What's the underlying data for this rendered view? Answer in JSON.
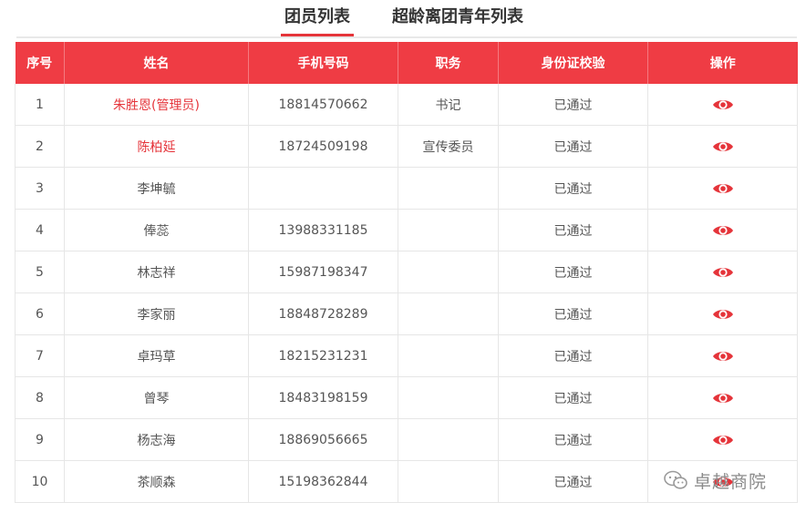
{
  "tabs": [
    {
      "label": "团员列表",
      "active": true
    },
    {
      "label": "超龄离团青年列表",
      "active": false
    }
  ],
  "table": {
    "headers": [
      "序号",
      "姓名",
      "手机号码",
      "职务",
      "身份证校验",
      "操作"
    ],
    "rows": [
      {
        "no": "1",
        "name": "朱胜恩(管理员)",
        "phone": "18814570662",
        "role": "书记",
        "id_check": "已通过",
        "highlight": true
      },
      {
        "no": "2",
        "name": "陈柏延",
        "phone": "18724509198",
        "role": "宣传委员",
        "id_check": "已通过",
        "highlight": true
      },
      {
        "no": "3",
        "name": "李坤毓",
        "phone": "",
        "role": "",
        "id_check": "已通过",
        "highlight": false
      },
      {
        "no": "4",
        "name": "俸蕊",
        "phone": "13988331185",
        "role": "",
        "id_check": "已通过",
        "highlight": false
      },
      {
        "no": "5",
        "name": "林志祥",
        "phone": "15987198347",
        "role": "",
        "id_check": "已通过",
        "highlight": false
      },
      {
        "no": "6",
        "name": "李家丽",
        "phone": "18848728289",
        "role": "",
        "id_check": "已通过",
        "highlight": false
      },
      {
        "no": "7",
        "name": "卓玛草",
        "phone": "18215231231",
        "role": "",
        "id_check": "已通过",
        "highlight": false
      },
      {
        "no": "8",
        "name": "曾琴",
        "phone": "18483198159",
        "role": "",
        "id_check": "已通过",
        "highlight": false
      },
      {
        "no": "9",
        "name": "杨志海",
        "phone": "18869056665",
        "role": "",
        "id_check": "已通过",
        "highlight": false
      },
      {
        "no": "10",
        "name": "茶顺森",
        "phone": "15198362844",
        "role": "",
        "id_check": "已通过",
        "highlight": false
      }
    ],
    "action_icon": "eye-icon"
  },
  "watermark": {
    "text": "卓越商院",
    "icon": "wechat-icon"
  },
  "colors": {
    "accent": "#ef3c44",
    "highlight_text": "#e5343a"
  }
}
